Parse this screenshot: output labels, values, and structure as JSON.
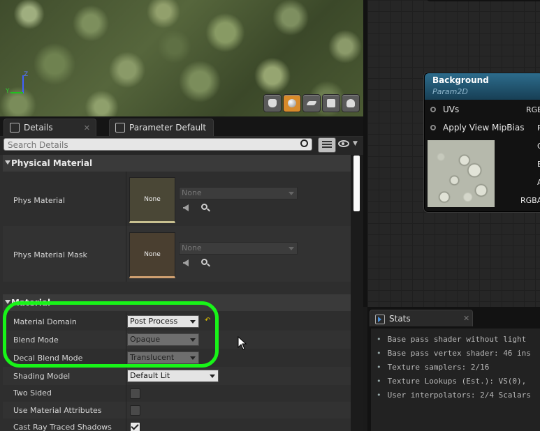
{
  "viewport": {
    "gizmo": {
      "axis_z": "Z",
      "axis_y": "Y"
    },
    "preview_buttons": [
      "cylinder",
      "sphere",
      "plane",
      "cube",
      "teapot"
    ],
    "active_preview": "sphere"
  },
  "tabs": {
    "details": "Details",
    "parameter_defaults": "Parameter Defaults",
    "close_glyph": "✕"
  },
  "search": {
    "placeholder": "Search Details"
  },
  "categories": {
    "physical_material": "Physical Material",
    "material": "Material"
  },
  "physical_material": {
    "phys_material": {
      "label": "Phys Material",
      "thumb_text": "None",
      "value": "None"
    },
    "phys_material_mask": {
      "label": "Phys Material Mask",
      "thumb_text": "None",
      "value": "None"
    }
  },
  "material": {
    "material_domain": {
      "label": "Material Domain",
      "value": "Post Process"
    },
    "blend_mode": {
      "label": "Blend Mode",
      "value": "Opaque"
    },
    "decal_blend_mode": {
      "label": "Decal Blend Mode",
      "value": "Translucent"
    },
    "shading_model": {
      "label": "Shading Model",
      "value": "Default Lit"
    },
    "two_sided": {
      "label": "Two Sided",
      "checked": false
    },
    "use_material_attributes": {
      "label": "Use Material Attributes",
      "checked": false
    },
    "cast_ray_traced_shadows": {
      "label": "Cast Ray Traced Shadows",
      "checked": true
    }
  },
  "node": {
    "title": "Background",
    "subtitle": "Param2D",
    "inputs": [
      "UVs",
      "Apply View MipBias"
    ],
    "outputs": [
      "RGB",
      "R",
      "G",
      "B",
      "A",
      "RGBA"
    ]
  },
  "stats": {
    "tab": "Stats",
    "close_glyph": "✕",
    "lines": [
      "Base pass shader without light",
      "Base pass vertex shader: 46 ins",
      "Texture samplers: 2/16",
      "Texture Lookups (Est.): VS(0),",
      "User interpolators: 2/4 Scalars"
    ]
  },
  "colors": {
    "highlight": "#18f418",
    "node_header": "#2d6c8c",
    "active_preview": "#d88a2a"
  }
}
